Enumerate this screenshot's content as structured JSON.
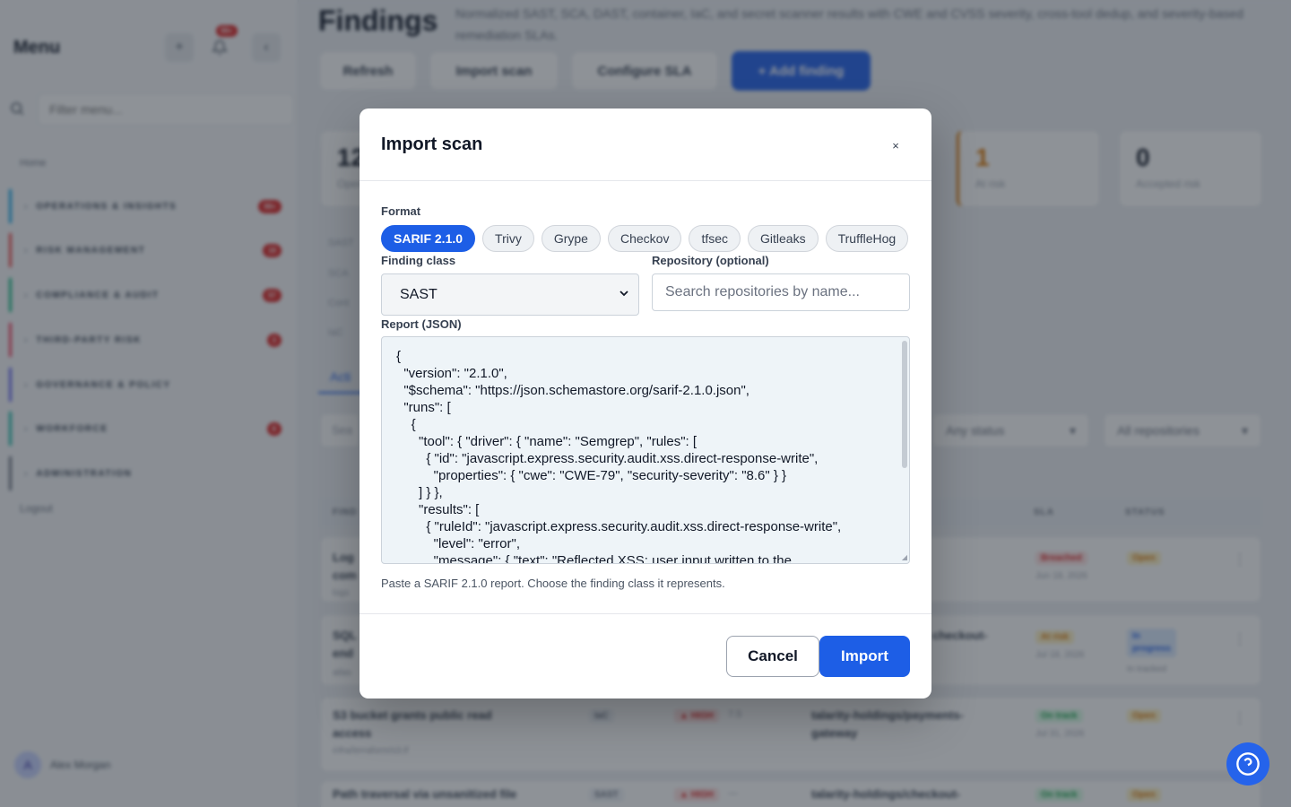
{
  "sidebar": {
    "title": "Menu",
    "notification_count": "99+",
    "filter_placeholder": "Filter menu...",
    "home_label": "Home",
    "items": [
      {
        "label": "OPERATIONS & INSIGHTS",
        "count": "99+",
        "color": "#0ea5e9"
      },
      {
        "label": "RISK MANAGEMENT",
        "count": "19",
        "color": "#ef4444"
      },
      {
        "label": "COMPLIANCE & AUDIT",
        "count": "57",
        "color": "#10b981"
      },
      {
        "label": "THIRD-PARTY RISK",
        "count": "3",
        "color": "#f43f5e"
      },
      {
        "label": "GOVERNANCE & POLICY",
        "count": "",
        "color": "#6366f1"
      },
      {
        "label": "WORKFORCE",
        "count": "8",
        "color": "#14b8a6"
      },
      {
        "label": "ADMINISTRATION",
        "count": "",
        "color": "#6b7280"
      }
    ],
    "logout_label": "Logout",
    "user_name": "Alex Morgan"
  },
  "page": {
    "title": "Findings",
    "description": "Normalized SAST, SCA, DAST, container, IaC, and secret scanner results with CWE and CVSS severity, cross-tool dedup, and severity-based remediation SLAs.",
    "buttons": {
      "refresh": "Refresh",
      "import_scan": "Import scan",
      "configure_sla": "Configure SLA",
      "add_finding": "+ Add finding"
    },
    "stats": [
      {
        "num": "12",
        "sub": "Open"
      },
      {
        "num": "1",
        "sub": "At risk"
      },
      {
        "num": "0",
        "sub": "Accepted risk"
      }
    ],
    "severity_labels": [
      "SAST",
      "SCA",
      "Cont",
      "IaC"
    ],
    "tab_active": "Acti",
    "search_placeholder": "Sea",
    "status_filter": "Any status",
    "repo_filter": "All repositories",
    "table_headers": {
      "finding": "FIND",
      "sla": "SLA",
      "status": "STATUS"
    },
    "rows": [
      {
        "title": "Log\ncom",
        "sub": "logs",
        "sla": "Breached",
        "sla_date": "Jun 18, 2026",
        "status": "Open"
      },
      {
        "title": "SQL\nend",
        "sub": "atlas",
        "repo": "checkout-",
        "sla": "At risk",
        "sla_date": "Jul 18, 2026",
        "status": "In\nprogress",
        "status_sub": "In tracked"
      },
      {
        "title": "S3 bucket grants public read\naccess",
        "sub": "infra/terraform/s3.tf",
        "type": "IaC",
        "sev": "HIGH",
        "score": "7.5",
        "repo": "talarity-holdings/payments-\ngateway",
        "sla": "On track",
        "sla_date": "Jul 31, 2026",
        "status": "Open"
      },
      {
        "title": "Path traversal via unsanitized file",
        "type": "SAST",
        "sev": "HIGH",
        "score": "—",
        "repo": "talarity-holdings/checkout-",
        "sla": "On track",
        "status": "Open"
      }
    ]
  },
  "modal": {
    "title": "Import scan",
    "close_label": "×",
    "format_label": "Format",
    "formats": [
      "SARIF 2.1.0",
      "Trivy",
      "Grype",
      "Checkov",
      "tfsec",
      "Gitleaks",
      "TruffleHog"
    ],
    "active_format": "SARIF 2.1.0",
    "finding_class_label": "Finding class",
    "finding_class_value": "SAST",
    "repository_label": "Repository (optional)",
    "repository_placeholder": "Search repositories by name...",
    "report_label": "Report (JSON)",
    "report_text": "{\n  \"version\": \"2.1.0\",\n  \"$schema\": \"https://json.schemastore.org/sarif-2.1.0.json\",\n  \"runs\": [\n    {\n      \"tool\": { \"driver\": { \"name\": \"Semgrep\", \"rules\": [\n        { \"id\": \"javascript.express.security.audit.xss.direct-response-write\",\n          \"properties\": { \"cwe\": \"CWE-79\", \"security-severity\": \"8.6\" } }\n      ] } },\n      \"results\": [\n        { \"ruleId\": \"javascript.express.security.audit.xss.direct-response-write\",\n          \"level\": \"error\",\n          \"message\": { \"text\": \"Reflected XSS: user input written to the",
    "hint": "Paste a SARIF 2.1.0 report. Choose the finding class it represents.",
    "cancel_label": "Cancel",
    "import_label": "Import"
  },
  "colors": {
    "primary": "#1d5ee6",
    "danger": "#dc2626",
    "warning": "#d97706"
  }
}
